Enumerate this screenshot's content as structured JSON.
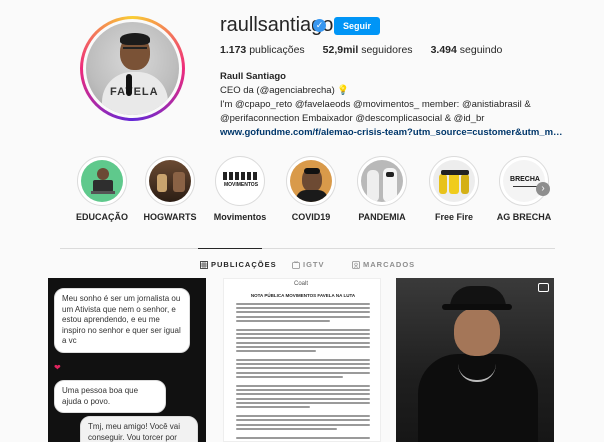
{
  "profile": {
    "username": "raullsantiago",
    "follow_label": "Seguir",
    "stats": {
      "posts_count": "1.173",
      "posts_label": "publicações",
      "followers_count": "52,9mil",
      "followers_label": "seguidores",
      "following_count": "3.494",
      "following_label": "seguindo"
    },
    "bio": {
      "name": "Raull Santiago",
      "line1": "CEO da (@agenciabrecha) 💡",
      "line2": "I'm @cpapo_reto @favelaeods @movimentos_ member: @anistiabrasil &",
      "line3": "@perifaconnection Embaixador @descomplicasocial & @id_br",
      "link": "www.gofundme.com/f/alemao-crisis-team?utm_source=customer&utm_medium=c..."
    },
    "avatar_shirt_text": "FAVELA"
  },
  "highlights": [
    {
      "label": "EDUCAÇÃO",
      "icon": "education-icon"
    },
    {
      "label": "HOGWARTS",
      "icon": "hogwarts-icon"
    },
    {
      "label": "Movimentos",
      "icon": "movimentos-icon",
      "inner_text": "MOVIMENTOS"
    },
    {
      "label": "COVID19",
      "icon": "covid-icon"
    },
    {
      "label": "PANDEMIA",
      "icon": "pandemia-icon"
    },
    {
      "label": "Free Fire",
      "icon": "free-fire-icon"
    },
    {
      "label": "AG BRECHA",
      "icon": "ag-brecha-icon",
      "inner_text": "BRECHA"
    }
  ],
  "tabs": [
    {
      "label": "PUBLICAÇÕES",
      "icon": "grid-icon",
      "active": true
    },
    {
      "label": "IGTV",
      "icon": "igtv-icon",
      "active": false
    },
    {
      "label": "MARCADOS",
      "icon": "tagged-icon",
      "active": false
    }
  ],
  "posts": {
    "post1": {
      "bubble1": "Meu sonho é ser um jornalista ou um Ativista que nem o senhor, e estou aprendendo, e eu me inspiro no senhor e quer ser igual a vc",
      "heart": "❤",
      "bubble2": "Uma pessoa boa que ajuda o povo.",
      "bubble3": "Tmj, meu amigo! Você vai conseguir. Vou torcer por você! 🙏✨"
    },
    "post2": {
      "logo": "Coalt",
      "title": "NOTA PÚBLICA MOVIMENTOS FAVELA NA LUTA"
    }
  },
  "colors": {
    "accent": "#0095f6",
    "verified": "#3897f0",
    "text": "#262626",
    "muted": "#8e8e8e",
    "link": "#00376b"
  }
}
